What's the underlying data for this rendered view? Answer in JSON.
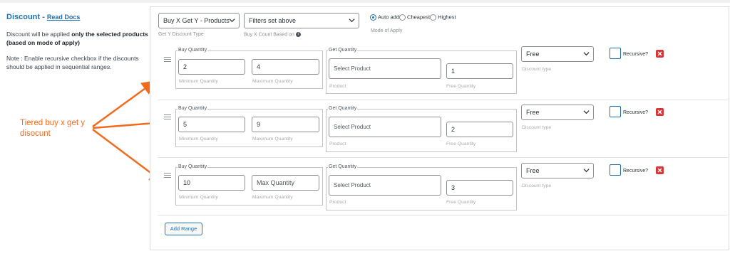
{
  "left": {
    "title": "Discount",
    "dash": " - ",
    "read_docs": "Read Docs",
    "desc_prefix": "Discount will be applied ",
    "desc_bold": "only the selected products (based on mode of apply)",
    "note": "Note : Enable recursive checkbox if the discounts should be applied in sequential ranges."
  },
  "annotation": {
    "line1": "Tiered buy x get y",
    "line2": "disocunt",
    "color": "#f26b1d"
  },
  "top": {
    "discount_type_value": "Buy X Get Y - Products",
    "discount_type_hint": "Get Y Discount Type",
    "count_based_value": "Filters set above",
    "count_based_hint": "Buy X Count Based on",
    "info_icon": "i",
    "mode_hint": "Mode of Apply",
    "modes": [
      {
        "label": "Auto add",
        "selected": true
      },
      {
        "label": "Cheapest",
        "selected": false
      },
      {
        "label": "Highest",
        "selected": false
      }
    ]
  },
  "labels": {
    "buy_quantity": "Buy Quantity",
    "get_quantity": "Get Quantity",
    "min_quantity": "Minimum Quantity",
    "max_quantity": "Maximum Quantity",
    "product": "Product",
    "free_quantity": "Free Quantity",
    "discount_type": "Discount type",
    "recursive": "Recursive?",
    "select_product": "Select Product"
  },
  "ranges": [
    {
      "min": "2",
      "max": "4",
      "max_placeholder": "",
      "free_qty": "1",
      "discount_type": "Free"
    },
    {
      "min": "5",
      "max": "9",
      "max_placeholder": "",
      "free_qty": "2",
      "discount_type": "Free"
    },
    {
      "min": "10",
      "max": "",
      "max_placeholder": "Max Quantity",
      "free_qty": "3",
      "discount_type": "Free"
    }
  ],
  "add_range": "Add Range",
  "colors": {
    "accent": "#2271b1",
    "delete": "#d63638",
    "annotation": "#f26b1d"
  }
}
